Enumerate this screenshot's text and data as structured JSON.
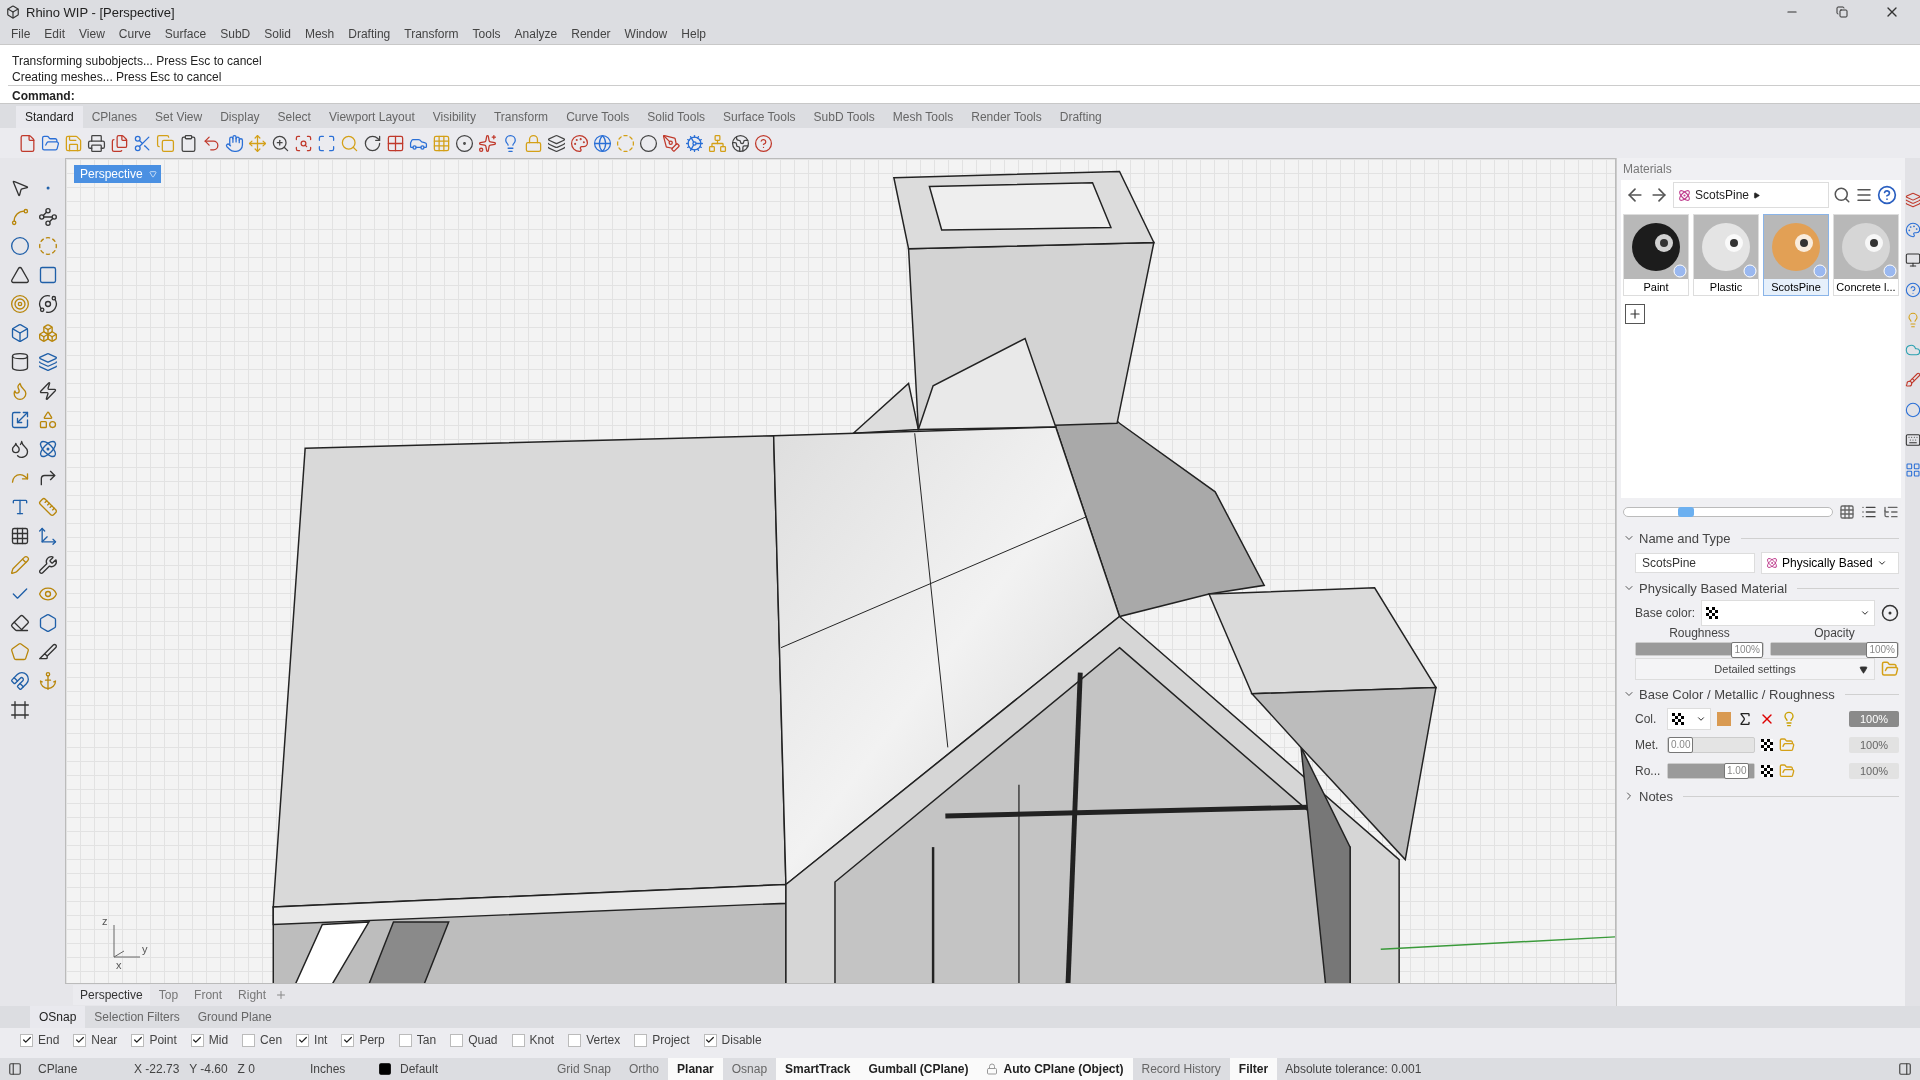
{
  "window": {
    "title": "Rhino WIP - [Perspective]"
  },
  "menu": [
    "File",
    "Edit",
    "View",
    "Curve",
    "Surface",
    "SubD",
    "Solid",
    "Mesh",
    "Drafting",
    "Transform",
    "Tools",
    "Analyze",
    "Render",
    "Window",
    "Help"
  ],
  "command_history": [
    "Transforming subobjects... Press Esc to cancel",
    "Creating meshes... Press Esc to cancel"
  ],
  "command_prompt": "Command:",
  "toolbar_tabs": [
    {
      "label": "Standard",
      "selected": true
    },
    {
      "label": "CPlanes",
      "selected": false
    },
    {
      "label": "Set View",
      "selected": false
    },
    {
      "label": "Display",
      "selected": false
    },
    {
      "label": "Select",
      "selected": false
    },
    {
      "label": "Viewport Layout",
      "selected": false
    },
    {
      "label": "Visibility",
      "selected": false
    },
    {
      "label": "Transform",
      "selected": false
    },
    {
      "label": "Curve Tools",
      "selected": false
    },
    {
      "label": "Solid Tools",
      "selected": false
    },
    {
      "label": "Surface Tools",
      "selected": false
    },
    {
      "label": "SubD Tools",
      "selected": false
    },
    {
      "label": "Mesh Tools",
      "selected": false
    },
    {
      "label": "Render Tools",
      "selected": false
    },
    {
      "label": "Drafting",
      "selected": false
    }
  ],
  "viewport": {
    "label": "Perspective",
    "axes": [
      "z",
      "y",
      "x"
    ]
  },
  "viewport_tabs": [
    {
      "label": "Perspective",
      "selected": true
    },
    {
      "label": "Top",
      "selected": false
    },
    {
      "label": "Front",
      "selected": false
    },
    {
      "label": "Right",
      "selected": false
    }
  ],
  "materials": {
    "title": "Materials",
    "breadcrumb": "ScotsPine",
    "items": [
      {
        "name": "Paint",
        "color": "#1c1c1c",
        "selected": false
      },
      {
        "name": "Plastic",
        "color": "#e4e4e4",
        "selected": false
      },
      {
        "name": "ScotsPine",
        "color": "#e2a055",
        "selected": true
      },
      {
        "name": "Concrete l...",
        "color": "#d6d6d6",
        "selected": false
      }
    ],
    "thumbnail_size": {
      "level": 0.3
    },
    "name_and_type": {
      "title": "Name and Type",
      "expanded": true,
      "name": "ScotsPine",
      "type": "Physically Based"
    },
    "pbr": {
      "title": "Physically Based Material",
      "expanded": true,
      "base_color_label": "Base color:",
      "detailed_settings": "Detailed settings",
      "sliders": [
        {
          "label": "Roughness",
          "level": 1,
          "reading": "100%"
        },
        {
          "label": "Opacity",
          "level": 1,
          "reading": "100%"
        }
      ]
    },
    "channels": {
      "title": "Base Color /  Metallic / Roughness",
      "expanded": true,
      "rows": [
        {
          "label": "Col.",
          "kind": "color",
          "amount": "100%",
          "enabled": true
        },
        {
          "label": "Met.",
          "kind": "slider",
          "level": 0,
          "reading": "0.00",
          "amount": "100%",
          "enabled": false
        },
        {
          "label": "Ro...",
          "kind": "slider",
          "level": 1,
          "reading": "1.00",
          "amount": "100%",
          "enabled": false
        }
      ]
    },
    "notes": {
      "title": "Notes",
      "expanded": false
    }
  },
  "panel_tabs": [
    {
      "label": "OSnap",
      "selected": true
    },
    {
      "label": "Selection Filters",
      "selected": false
    },
    {
      "label": "Ground Plane",
      "selected": false
    }
  ],
  "osnaps": [
    {
      "label": "End",
      "checked": true
    },
    {
      "label": "Near",
      "checked": true
    },
    {
      "label": "Point",
      "checked": true
    },
    {
      "label": "Mid",
      "checked": true
    },
    {
      "label": "Cen",
      "checked": false
    },
    {
      "label": "Int",
      "checked": true
    },
    {
      "label": "Perp",
      "checked": true
    },
    {
      "label": "Tan",
      "checked": false
    },
    {
      "label": "Quad",
      "checked": false
    },
    {
      "label": "Knot",
      "checked": false
    },
    {
      "label": "Vertex",
      "checked": false
    },
    {
      "label": "Project",
      "checked": false
    },
    {
      "label": "Disable",
      "checked": true
    }
  ],
  "status_bar": {
    "cplane": "CPlane",
    "coordinates": "X -22.73   Y -4.60   Z 0",
    "units": "Inches",
    "layer": "Default",
    "toggles": [
      {
        "label": "Grid Snap",
        "on": false,
        "kind": "plain"
      },
      {
        "label": "Ortho",
        "on": false,
        "kind": "plain"
      },
      {
        "label": "Planar",
        "on": true,
        "kind": "plain"
      },
      {
        "label": "Osnap",
        "on": false,
        "kind": "plain"
      },
      {
        "label": "SmartTrack",
        "on": true,
        "kind": "plain"
      },
      {
        "label": "Gumball (CPlane)",
        "on": true,
        "kind": "plain"
      },
      {
        "label": "Auto CPlane (Object)",
        "on": true,
        "kind": "lock"
      },
      {
        "label": "Record History",
        "on": false,
        "kind": "plain"
      },
      {
        "label": "Filter",
        "on": true,
        "kind": "plain"
      }
    ],
    "tolerance": "Absolute tolerance: 0.001"
  }
}
